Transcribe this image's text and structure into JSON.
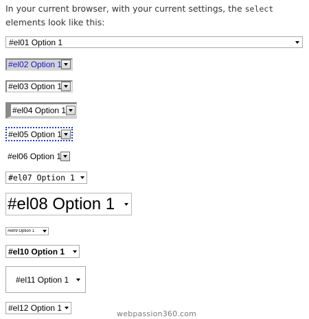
{
  "intro": {
    "part1": "In your current browser, with your current settings, the ",
    "code": "select",
    "part2": " elements look like this:"
  },
  "selects": {
    "el01": "#el01 Option 1",
    "el02": "#el02 Option 1",
    "el03": "#el03 Option 1",
    "el04": "#el04 Option 1",
    "el05": "#el05 Option 1",
    "el06": "#el06 Option 1",
    "el07": "#el07 Option 1",
    "el08": "#el08 Option 1",
    "el09": "#el09 Option 1",
    "el10": "#el10 Option 1",
    "el11": "#el11 Option 1",
    "el12": "#el12 Option 1"
  },
  "watermark": "webpassion360.com",
  "icons": {
    "dropdown": "chevron-down-icon"
  },
  "colors": {
    "el02_text": "#1515cc",
    "el05_focus_border": "#1c3cb8"
  }
}
